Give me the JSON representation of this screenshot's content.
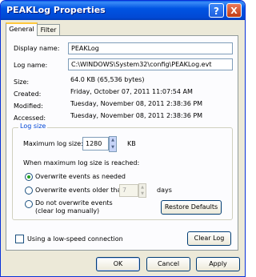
{
  "window": {
    "title": "PEAKLog Properties",
    "help_button": "?",
    "close_button": "X"
  },
  "tabs": [
    {
      "label": "General",
      "active": true
    },
    {
      "label": "Filter",
      "active": false
    }
  ],
  "general": {
    "display_name_label": "Display name:",
    "display_name_value": "PEAKLog",
    "log_name_label": "Log name:",
    "log_name_value": "C:\\WINDOWS\\System32\\config\\PEAKLog.evt",
    "size_label": "Size:",
    "size_value": "64.0 KB (65,536 bytes)",
    "created_label": "Created:",
    "created_value": "Friday, October 07, 2011 11:07:54 AM",
    "modified_label": "Modified:",
    "modified_value": "Tuesday, November 08, 2011 2:38:36 PM",
    "accessed_label": "Accessed:",
    "accessed_value": "Tuesday, November 08, 2011 2:38:36 PM"
  },
  "log_size": {
    "legend": "Log size",
    "max_label": "Maximum log size:",
    "max_value": "1280",
    "max_unit": "KB",
    "reached_label": "When maximum log size is reached:",
    "options": [
      {
        "label": "Overwrite events as needed",
        "selected": true
      },
      {
        "label": "Overwrite events older than",
        "selected": false
      },
      {
        "label": "Do not overwrite events",
        "sub": "(clear log manually)",
        "selected": false
      }
    ],
    "days_value": "7",
    "days_unit": "days",
    "restore_button": "Restore Defaults"
  },
  "low_speed": {
    "label": "Using a low-speed connection",
    "checked": false
  },
  "clear_log_button": "Clear Log",
  "footer": {
    "ok": "OK",
    "cancel": "Cancel",
    "apply": "Apply"
  },
  "colors": {
    "title_bar": "#0054e3",
    "accent": "#0046d5",
    "tab_highlight": "#ffc83c",
    "radio_dot": "#21a121"
  }
}
